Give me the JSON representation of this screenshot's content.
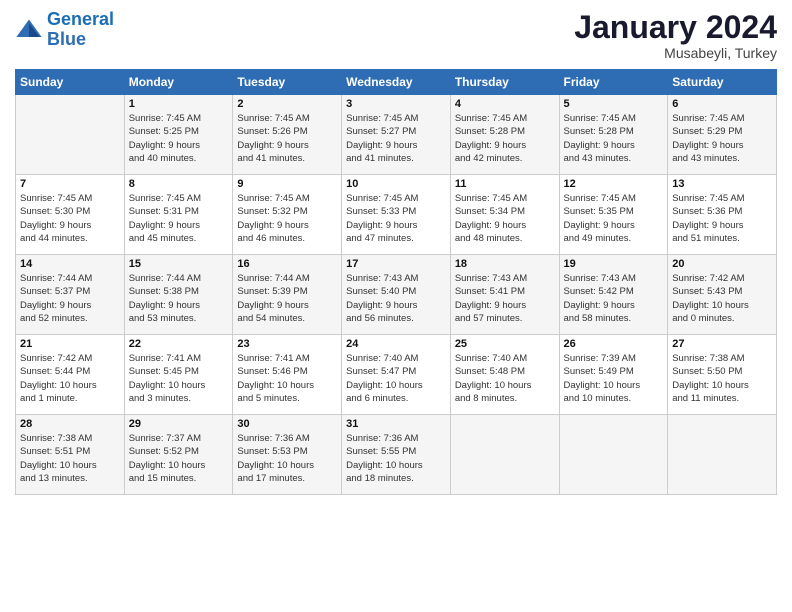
{
  "logo": {
    "line1": "General",
    "line2": "Blue"
  },
  "title": "January 2024",
  "location": "Musabeyli, Turkey",
  "days_header": [
    "Sunday",
    "Monday",
    "Tuesday",
    "Wednesday",
    "Thursday",
    "Friday",
    "Saturday"
  ],
  "weeks": [
    [
      {
        "num": "",
        "info": ""
      },
      {
        "num": "1",
        "info": "Sunrise: 7:45 AM\nSunset: 5:25 PM\nDaylight: 9 hours\nand 40 minutes."
      },
      {
        "num": "2",
        "info": "Sunrise: 7:45 AM\nSunset: 5:26 PM\nDaylight: 9 hours\nand 41 minutes."
      },
      {
        "num": "3",
        "info": "Sunrise: 7:45 AM\nSunset: 5:27 PM\nDaylight: 9 hours\nand 41 minutes."
      },
      {
        "num": "4",
        "info": "Sunrise: 7:45 AM\nSunset: 5:28 PM\nDaylight: 9 hours\nand 42 minutes."
      },
      {
        "num": "5",
        "info": "Sunrise: 7:45 AM\nSunset: 5:28 PM\nDaylight: 9 hours\nand 43 minutes."
      },
      {
        "num": "6",
        "info": "Sunrise: 7:45 AM\nSunset: 5:29 PM\nDaylight: 9 hours\nand 43 minutes."
      }
    ],
    [
      {
        "num": "7",
        "info": "Sunrise: 7:45 AM\nSunset: 5:30 PM\nDaylight: 9 hours\nand 44 minutes."
      },
      {
        "num": "8",
        "info": "Sunrise: 7:45 AM\nSunset: 5:31 PM\nDaylight: 9 hours\nand 45 minutes."
      },
      {
        "num": "9",
        "info": "Sunrise: 7:45 AM\nSunset: 5:32 PM\nDaylight: 9 hours\nand 46 minutes."
      },
      {
        "num": "10",
        "info": "Sunrise: 7:45 AM\nSunset: 5:33 PM\nDaylight: 9 hours\nand 47 minutes."
      },
      {
        "num": "11",
        "info": "Sunrise: 7:45 AM\nSunset: 5:34 PM\nDaylight: 9 hours\nand 48 minutes."
      },
      {
        "num": "12",
        "info": "Sunrise: 7:45 AM\nSunset: 5:35 PM\nDaylight: 9 hours\nand 49 minutes."
      },
      {
        "num": "13",
        "info": "Sunrise: 7:45 AM\nSunset: 5:36 PM\nDaylight: 9 hours\nand 51 minutes."
      }
    ],
    [
      {
        "num": "14",
        "info": "Sunrise: 7:44 AM\nSunset: 5:37 PM\nDaylight: 9 hours\nand 52 minutes."
      },
      {
        "num": "15",
        "info": "Sunrise: 7:44 AM\nSunset: 5:38 PM\nDaylight: 9 hours\nand 53 minutes."
      },
      {
        "num": "16",
        "info": "Sunrise: 7:44 AM\nSunset: 5:39 PM\nDaylight: 9 hours\nand 54 minutes."
      },
      {
        "num": "17",
        "info": "Sunrise: 7:43 AM\nSunset: 5:40 PM\nDaylight: 9 hours\nand 56 minutes."
      },
      {
        "num": "18",
        "info": "Sunrise: 7:43 AM\nSunset: 5:41 PM\nDaylight: 9 hours\nand 57 minutes."
      },
      {
        "num": "19",
        "info": "Sunrise: 7:43 AM\nSunset: 5:42 PM\nDaylight: 9 hours\nand 58 minutes."
      },
      {
        "num": "20",
        "info": "Sunrise: 7:42 AM\nSunset: 5:43 PM\nDaylight: 10 hours\nand 0 minutes."
      }
    ],
    [
      {
        "num": "21",
        "info": "Sunrise: 7:42 AM\nSunset: 5:44 PM\nDaylight: 10 hours\nand 1 minute."
      },
      {
        "num": "22",
        "info": "Sunrise: 7:41 AM\nSunset: 5:45 PM\nDaylight: 10 hours\nand 3 minutes."
      },
      {
        "num": "23",
        "info": "Sunrise: 7:41 AM\nSunset: 5:46 PM\nDaylight: 10 hours\nand 5 minutes."
      },
      {
        "num": "24",
        "info": "Sunrise: 7:40 AM\nSunset: 5:47 PM\nDaylight: 10 hours\nand 6 minutes."
      },
      {
        "num": "25",
        "info": "Sunrise: 7:40 AM\nSunset: 5:48 PM\nDaylight: 10 hours\nand 8 minutes."
      },
      {
        "num": "26",
        "info": "Sunrise: 7:39 AM\nSunset: 5:49 PM\nDaylight: 10 hours\nand 10 minutes."
      },
      {
        "num": "27",
        "info": "Sunrise: 7:38 AM\nSunset: 5:50 PM\nDaylight: 10 hours\nand 11 minutes."
      }
    ],
    [
      {
        "num": "28",
        "info": "Sunrise: 7:38 AM\nSunset: 5:51 PM\nDaylight: 10 hours\nand 13 minutes."
      },
      {
        "num": "29",
        "info": "Sunrise: 7:37 AM\nSunset: 5:52 PM\nDaylight: 10 hours\nand 15 minutes."
      },
      {
        "num": "30",
        "info": "Sunrise: 7:36 AM\nSunset: 5:53 PM\nDaylight: 10 hours\nand 17 minutes."
      },
      {
        "num": "31",
        "info": "Sunrise: 7:36 AM\nSunset: 5:55 PM\nDaylight: 10 hours\nand 18 minutes."
      },
      {
        "num": "",
        "info": ""
      },
      {
        "num": "",
        "info": ""
      },
      {
        "num": "",
        "info": ""
      }
    ]
  ]
}
